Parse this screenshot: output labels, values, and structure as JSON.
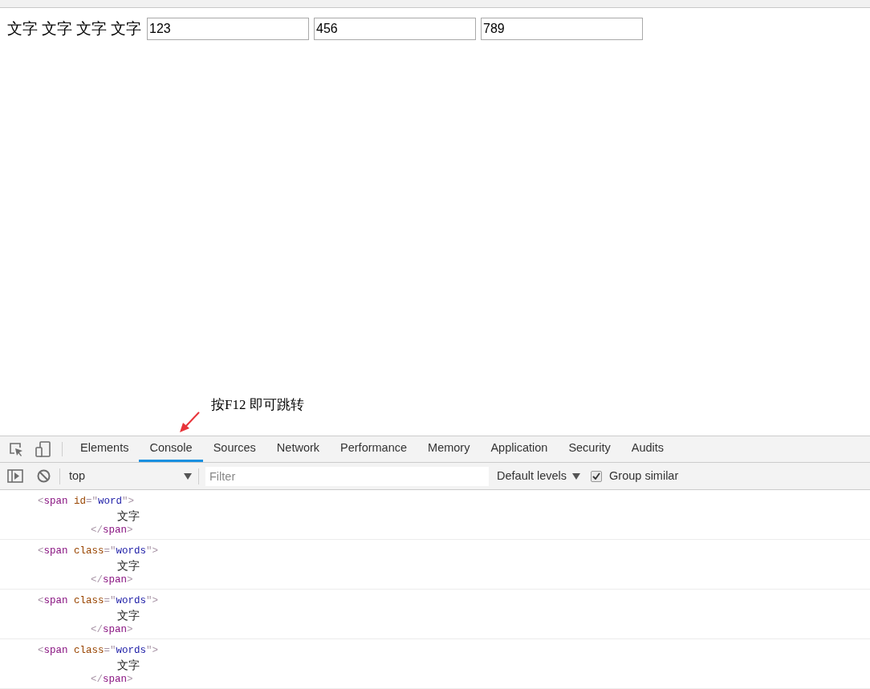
{
  "page": {
    "words": [
      "文字",
      "文字",
      "文字",
      "文字"
    ],
    "inputs": [
      {
        "value": "123"
      },
      {
        "value": "456"
      },
      {
        "value": "789"
      }
    ]
  },
  "annotation": {
    "text": "按F12 即可跳转"
  },
  "devtools": {
    "tabs": [
      {
        "label": "Elements",
        "selected": false
      },
      {
        "label": "Console",
        "selected": true
      },
      {
        "label": "Sources",
        "selected": false
      },
      {
        "label": "Network",
        "selected": false
      },
      {
        "label": "Performance",
        "selected": false
      },
      {
        "label": "Memory",
        "selected": false
      },
      {
        "label": "Application",
        "selected": false
      },
      {
        "label": "Security",
        "selected": false
      },
      {
        "label": "Audits",
        "selected": false
      }
    ],
    "toolbar": {
      "context": "top",
      "filter_placeholder": "Filter",
      "levels": "Default levels",
      "group_similar": {
        "label": "Group similar",
        "checked": true
      }
    },
    "console_entries": [
      {
        "open": [
          {
            "kind": "punct",
            "text": "<"
          },
          {
            "kind": "tag",
            "text": "span"
          },
          {
            "kind": "attr",
            "text": " id"
          },
          {
            "kind": "punct",
            "text": "=\""
          },
          {
            "kind": "value",
            "text": "word"
          },
          {
            "kind": "punct",
            "text": "\">"
          }
        ],
        "content": "文字",
        "close": [
          {
            "kind": "punct",
            "text": "</"
          },
          {
            "kind": "tag",
            "text": "span"
          },
          {
            "kind": "punct",
            "text": ">"
          }
        ]
      },
      {
        "open": [
          {
            "kind": "punct",
            "text": "<"
          },
          {
            "kind": "tag",
            "text": "span"
          },
          {
            "kind": "attr",
            "text": " class"
          },
          {
            "kind": "punct",
            "text": "=\""
          },
          {
            "kind": "value",
            "text": "words"
          },
          {
            "kind": "punct",
            "text": "\">"
          }
        ],
        "content": "文字",
        "close": [
          {
            "kind": "punct",
            "text": "</"
          },
          {
            "kind": "tag",
            "text": "span"
          },
          {
            "kind": "punct",
            "text": ">"
          }
        ]
      },
      {
        "open": [
          {
            "kind": "punct",
            "text": "<"
          },
          {
            "kind": "tag",
            "text": "span"
          },
          {
            "kind": "attr",
            "text": " class"
          },
          {
            "kind": "punct",
            "text": "=\""
          },
          {
            "kind": "value",
            "text": "words"
          },
          {
            "kind": "punct",
            "text": "\">"
          }
        ],
        "content": "文字",
        "close": [
          {
            "kind": "punct",
            "text": "</"
          },
          {
            "kind": "tag",
            "text": "span"
          },
          {
            "kind": "punct",
            "text": ">"
          }
        ]
      },
      {
        "open": [
          {
            "kind": "punct",
            "text": "<"
          },
          {
            "kind": "tag",
            "text": "span"
          },
          {
            "kind": "attr",
            "text": " class"
          },
          {
            "kind": "punct",
            "text": "=\""
          },
          {
            "kind": "value",
            "text": "words"
          },
          {
            "kind": "punct",
            "text": "\">"
          }
        ],
        "content": "文字",
        "close": [
          {
            "kind": "punct",
            "text": "</"
          },
          {
            "kind": "tag",
            "text": "span"
          },
          {
            "kind": "punct",
            "text": ">"
          }
        ]
      }
    ]
  }
}
